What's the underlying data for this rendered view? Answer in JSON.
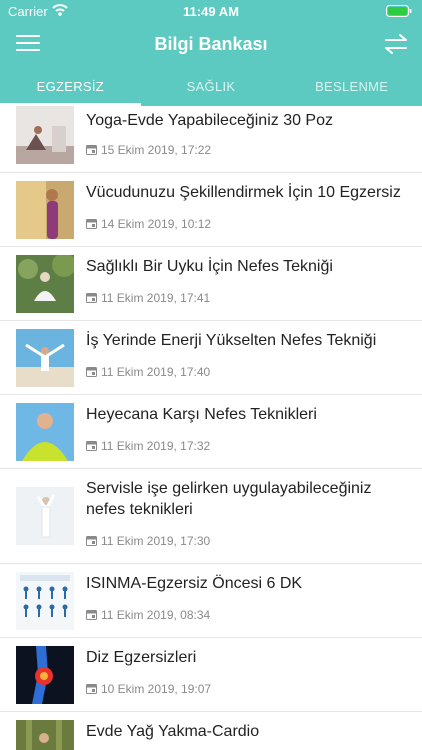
{
  "status": {
    "carrier": "Carrier",
    "time": "11:49 AM"
  },
  "nav": {
    "title": "Bilgi Bankası",
    "menu_icon": "hamburger-menu-icon",
    "swap_icon": "swap-arrows-icon"
  },
  "colors": {
    "primary": "#5ccac0",
    "text": "#222222",
    "muted": "#8a8a8a"
  },
  "tabs": [
    {
      "label": "EGZERSİZ",
      "active": true
    },
    {
      "label": "SAĞLIK",
      "active": false
    },
    {
      "label": "BESLENME",
      "active": false
    }
  ],
  "articles": [
    {
      "title": "Yoga-Evde Yapabileceğiniz 30 Poz",
      "date": "15 Ekim 2019, 17:22"
    },
    {
      "title": "Vücudunuzu Şekillendirmek İçin 10 Egzersiz",
      "date": "14 Ekim 2019, 10:12"
    },
    {
      "title": "Sağlıklı Bir Uyku İçin Nefes Tekniği",
      "date": "11 Ekim 2019, 17:41"
    },
    {
      "title": "İş Yerinde Enerji Yükselten Nefes Tekniği",
      "date": "11 Ekim 2019, 17:40"
    },
    {
      "title": "Heyecana Karşı Nefes Teknikleri",
      "date": "11 Ekim 2019, 17:32"
    },
    {
      "title": "Servisle işe gelirken uygulayabileceğiniz nefes teknikleri",
      "date": "11 Ekim 2019, 17:30"
    },
    {
      "title": "ISINMA-Egzersiz Öncesi 6 DK",
      "date": "11 Ekim 2019, 08:34"
    },
    {
      "title": "Diz Egzersizleri",
      "date": "10 Ekim 2019, 19:07"
    },
    {
      "title": "Evde Yağ Yakma-Cardio",
      "date": ""
    }
  ]
}
